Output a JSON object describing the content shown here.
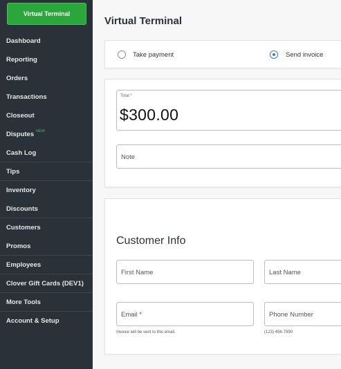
{
  "sidebar": {
    "primary_button": "Virtual Terminal",
    "items": [
      {
        "label": "Dashboard"
      },
      {
        "label": "Reporting"
      },
      {
        "label": "Orders"
      },
      {
        "label": "Transactions"
      },
      {
        "label": "Closeout"
      },
      {
        "label": "Disputes",
        "badge": "NEW"
      },
      {
        "label": "Cash Log"
      },
      {
        "label": "Tips"
      },
      {
        "label": "Inventory"
      },
      {
        "label": "Discounts"
      },
      {
        "label": "Customers"
      },
      {
        "label": "Promos"
      },
      {
        "label": "Employees"
      },
      {
        "label": "Clover Gift Cards (DEV1)"
      },
      {
        "label": "More Tools"
      },
      {
        "label": "Account & Setup"
      }
    ]
  },
  "main": {
    "title": "Virtual Terminal",
    "mode": {
      "options": [
        {
          "label": "Take payment",
          "selected": false
        },
        {
          "label": "Send invoice",
          "selected": true
        }
      ]
    },
    "payment": {
      "total_label": "Total *",
      "total_value": "$300.00",
      "note_placeholder": "Note"
    },
    "customer": {
      "title": "Customer Info",
      "first_name_placeholder": "First Name",
      "last_name_placeholder": "Last Name",
      "email_placeholder": "Email *",
      "email_hint": "Invoice will be sent to this email.",
      "phone_placeholder": "Phone Number",
      "phone_hint": "(123) 456-7890"
    }
  },
  "colors": {
    "sidebar_bg": "#2b3138",
    "accent_green": "#2aa63a",
    "radio_blue": "#3a7bd5"
  }
}
